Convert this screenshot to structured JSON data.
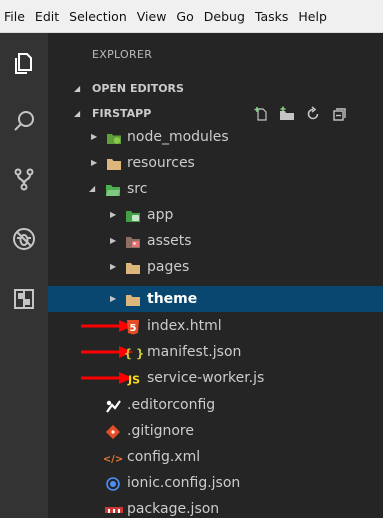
{
  "menu": [
    "File",
    "Edit",
    "Selection",
    "View",
    "Go",
    "Debug",
    "Tasks",
    "Help"
  ],
  "activity_bar": [
    "files-icon",
    "search-icon",
    "source-control-icon",
    "debug-icon",
    "extensions-icon"
  ],
  "sidebar": {
    "title": "EXPLORER",
    "sections": {
      "open_editors": "OPEN EDITORS",
      "project": "FIRSTAPP"
    },
    "tree": [
      {
        "label": "node_modules",
        "type": "folder",
        "icon": "node-folder-icon",
        "expanded": false
      },
      {
        "label": "resources",
        "type": "folder",
        "icon": "folder-icon",
        "expanded": false
      },
      {
        "label": "src",
        "type": "folder",
        "icon": "src-folder-icon",
        "expanded": true
      },
      {
        "label": "app",
        "type": "folder",
        "icon": "app-folder-icon",
        "expanded": false
      },
      {
        "label": "assets",
        "type": "folder",
        "icon": "assets-folder-icon",
        "expanded": false
      },
      {
        "label": "pages",
        "type": "folder",
        "icon": "folder-icon",
        "expanded": false
      },
      {
        "label": "theme",
        "type": "folder",
        "icon": "folder-icon",
        "expanded": false,
        "selected": true
      },
      {
        "label": "index.html",
        "type": "file",
        "icon": "html5-icon"
      },
      {
        "label": "manifest.json",
        "type": "file",
        "icon": "json-icon"
      },
      {
        "label": "service-worker.js",
        "type": "file",
        "icon": "javascript-icon"
      },
      {
        "label": ".editorconfig",
        "type": "file",
        "icon": "editorconfig-icon"
      },
      {
        "label": ".gitignore",
        "type": "file",
        "icon": "git-icon"
      },
      {
        "label": "config.xml",
        "type": "file",
        "icon": "xml-icon"
      },
      {
        "label": "ionic.config.json",
        "type": "file",
        "icon": "ionic-icon"
      },
      {
        "label": "package.json",
        "type": "file",
        "icon": "npm-icon"
      }
    ]
  },
  "colors": {
    "menubar_bg": "#f0f0f0",
    "activity_bg": "#333333",
    "sidebar_bg": "#252526",
    "selection_bg": "#094771",
    "annotation_arrow": "#ff0000",
    "folder": "#dcb67a"
  }
}
